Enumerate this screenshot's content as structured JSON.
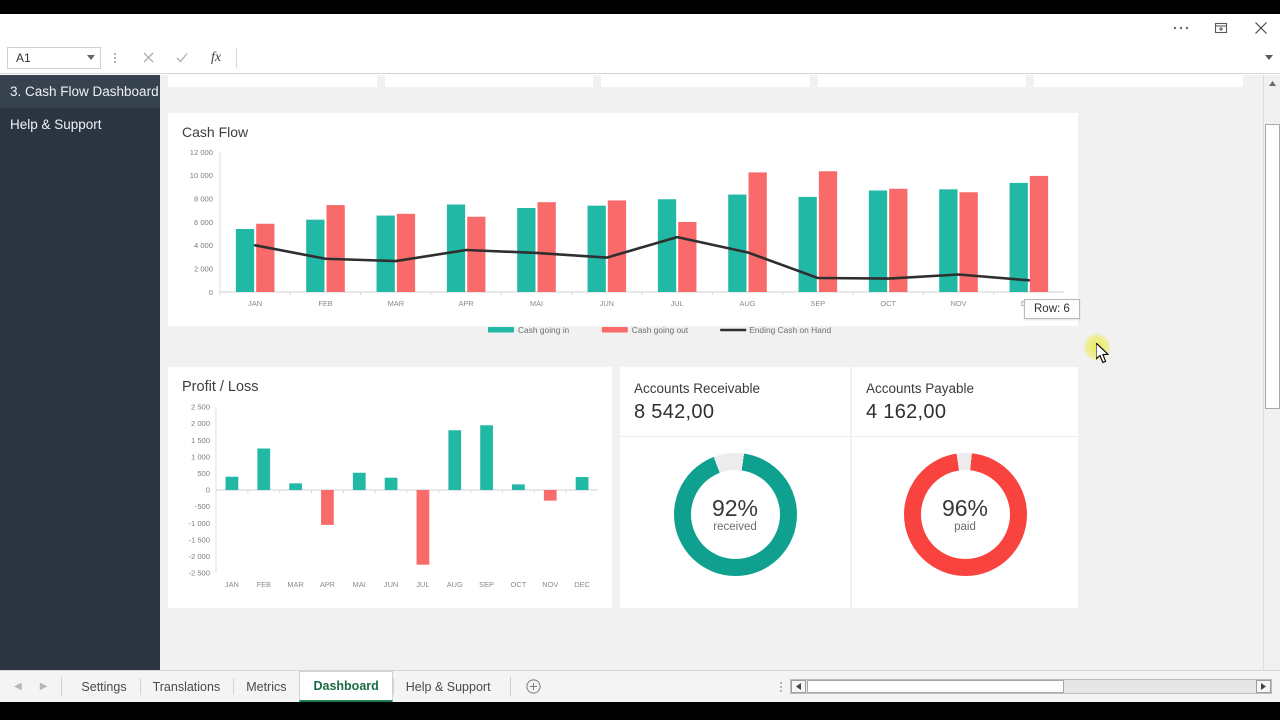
{
  "window": {
    "controls": [
      {
        "name": "more-options",
        "glyph": "•••"
      },
      {
        "name": "restore-window",
        "glyph": "❐"
      },
      {
        "name": "close-window",
        "glyph": "✕"
      }
    ]
  },
  "formula_bar": {
    "name_box_value": "A1",
    "formula_value": "",
    "formula_placeholder": "",
    "cancel_label": "✕",
    "enter_label": "✓",
    "fx_label": "fx"
  },
  "sidebar": {
    "items": [
      {
        "label": "3. Cash Flow Dashboard",
        "active": true
      },
      {
        "label": "Help & Support",
        "active": false
      }
    ]
  },
  "colors": {
    "teal": "#22b8a6",
    "coral": "#f96b6b",
    "line_dark": "#2f2f2f",
    "donut_track": "#ececec",
    "sidebar_bg": "#2b3542",
    "canvas_bg": "#f1f1f1",
    "active_tab_green": "#1b6a43"
  },
  "cash_flow_card": {
    "title": "Cash Flow"
  },
  "profit_loss_card": {
    "title": "Profit / Loss"
  },
  "accounts_receivable": {
    "title": "Accounts Receivable",
    "amount": "8 542,00",
    "percent": "92%",
    "percent_value": 92,
    "caption": "received",
    "color": "#0fa090"
  },
  "accounts_payable": {
    "title": "Accounts Payable",
    "amount": "4 162,00",
    "percent": "96%",
    "percent_value": 96,
    "caption": "paid",
    "color": "#f8433f"
  },
  "tooltip": {
    "text": "Row: 6"
  },
  "sheet_tabs": {
    "prev_label": "◀",
    "next_label": "▶",
    "add_label": "⊕",
    "items": [
      {
        "label": "Settings",
        "active": false
      },
      {
        "label": "Translations",
        "active": false
      },
      {
        "label": "Metrics",
        "active": false
      },
      {
        "label": "Dashboard",
        "active": true
      },
      {
        "label": "Help & Support",
        "active": false
      }
    ]
  },
  "scrollbars": {
    "v_up": "▲",
    "v_down": "▼",
    "h_left": "◀",
    "h_right": "▶"
  },
  "chart_data": [
    {
      "type": "bar",
      "id": "cash-flow",
      "title": "Cash Flow",
      "xlabel": "",
      "ylabel": "",
      "ylim": [
        0,
        12000
      ],
      "yticks": [
        0,
        2000,
        4000,
        6000,
        8000,
        10000,
        12000
      ],
      "ytick_labels": [
        "0",
        "2 000",
        "4 000",
        "6 000",
        "8 000",
        "10 000",
        "12 000"
      ],
      "categories": [
        "JAN",
        "FEB",
        "MAR",
        "APR",
        "MAI",
        "JUN",
        "JUL",
        "AUG",
        "SEP",
        "OCT",
        "NOV",
        "DEC"
      ],
      "grid": false,
      "legend_position": "bottom",
      "series": [
        {
          "name": "Cash going in",
          "type": "bar",
          "color": "#22b8a6",
          "values": [
            5400,
            6200,
            6550,
            7500,
            7200,
            7400,
            7950,
            8350,
            8150,
            8700,
            8800,
            9350
          ]
        },
        {
          "name": "Cash going out",
          "type": "bar",
          "color": "#f96b6b",
          "values": [
            5850,
            7450,
            6700,
            6450,
            7700,
            7850,
            6000,
            10250,
            10350,
            8850,
            8550,
            9950
          ]
        },
        {
          "name": "Ending Cash on Hand",
          "type": "line",
          "color": "#2f2f2f",
          "values": [
            4000,
            2850,
            2650,
            3600,
            3350,
            2950,
            4700,
            3400,
            1200,
            1150,
            1500,
            1000
          ]
        }
      ]
    },
    {
      "type": "bar",
      "id": "profit-loss",
      "title": "Profit / Loss",
      "xlabel": "",
      "ylabel": "",
      "ylim": [
        -2500,
        2500
      ],
      "yticks": [
        -2500,
        -2000,
        -1500,
        -1000,
        -500,
        0,
        500,
        1000,
        1500,
        2000,
        2500
      ],
      "ytick_labels": [
        "-2 500",
        "-2 000",
        "-1 500",
        "-1 000",
        "-500",
        "0",
        "500",
        "1 000",
        "1 500",
        "2 000",
        "2 500"
      ],
      "categories": [
        "JAN",
        "FEB",
        "MAR",
        "APR",
        "MAI",
        "JUN",
        "JUL",
        "AUG",
        "SEP",
        "OCT",
        "NOV",
        "DEC"
      ],
      "grid": false,
      "legend_position": "none",
      "positive_color": "#22b8a6",
      "negative_color": "#f96b6b",
      "values": [
        400,
        1250,
        200,
        -1050,
        520,
        370,
        -2250,
        1800,
        1950,
        170,
        -320,
        390
      ]
    },
    {
      "type": "pie",
      "id": "accounts-receivable-donut",
      "title": "Accounts Receivable",
      "labels": [
        "received",
        "remaining"
      ],
      "values": [
        92,
        8
      ],
      "colors": [
        "#0fa090",
        "#ececec"
      ]
    },
    {
      "type": "pie",
      "id": "accounts-payable-donut",
      "title": "Accounts Payable",
      "labels": [
        "paid",
        "remaining"
      ],
      "values": [
        96,
        4
      ],
      "colors": [
        "#f8433f",
        "#ececec"
      ]
    }
  ]
}
